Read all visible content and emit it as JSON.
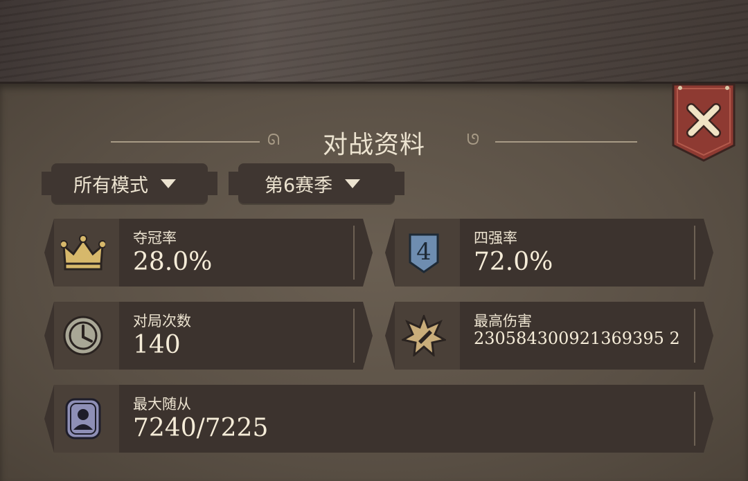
{
  "title": "对战资料",
  "close_icon": "close-x-icon",
  "filters": {
    "mode": "所有模式",
    "season": "第6赛季"
  },
  "stats": {
    "win_rate": {
      "label": "夺冠率",
      "value": "28.0%",
      "icon": "crown-icon"
    },
    "top4_rate": {
      "label": "四强率",
      "value": "72.0%",
      "icon": "four-shield-icon"
    },
    "matches": {
      "label": "对局次数",
      "value": "140",
      "icon": "clock-icon"
    },
    "max_damage": {
      "label": "最高伤害",
      "value": "230584300921369395 2",
      "icon": "damage-burst-icon"
    },
    "max_minions": {
      "label": "最大随从",
      "value": "7240/7225",
      "icon": "minion-portrait-icon"
    }
  },
  "colors": {
    "panel": "#5a5045",
    "card": "#3c332e",
    "text": "#ece3d0",
    "close_banner": "#8e3a32",
    "crown": "#d7b86b",
    "shield": "#6e8db0"
  }
}
